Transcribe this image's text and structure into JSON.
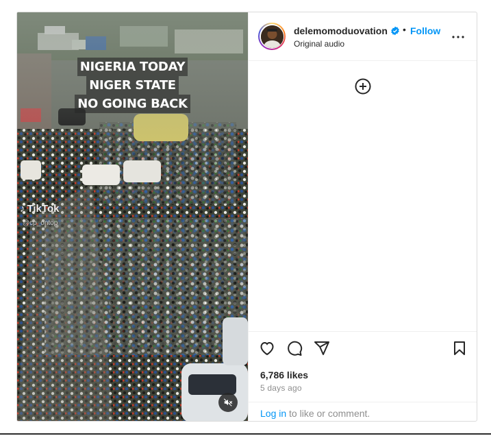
{
  "post": {
    "username": "delemomoduovation",
    "separator": "•",
    "follow_label": "Follow",
    "audio_label": "Original audio",
    "likes_text": "6,786 likes",
    "time_ago": "5 days ago",
    "login_link": "Log in",
    "login_suffix": " to like or comment."
  },
  "video": {
    "caption_lines": [
      "NIGERIA TODAY",
      "NIGER STATE",
      "NO GOING BACK"
    ],
    "watermark_brand": "TikTok",
    "watermark_note": "♪",
    "watermark_handle": "@cp_ontop"
  },
  "icons": {
    "verified": "verified-badge-icon",
    "more": "more-options-icon",
    "add": "plus-circle-icon",
    "like": "heart-icon",
    "comment": "comment-icon",
    "share": "share-icon",
    "save": "bookmark-icon",
    "mute": "muted-speaker-icon"
  },
  "colors": {
    "accent": "#0095f6",
    "text": "#262626",
    "muted": "#8e8e8e"
  }
}
